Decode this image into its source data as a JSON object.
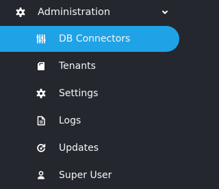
{
  "sidebar": {
    "group": {
      "label": "Administration",
      "icon": "gear-icon",
      "expanded": true
    },
    "items": [
      {
        "label": "DB Connectors",
        "icon": "sliders-icon",
        "active": true
      },
      {
        "label": "Tenants",
        "icon": "document-icon",
        "active": false
      },
      {
        "label": "Settings",
        "icon": "gear-icon",
        "active": false
      },
      {
        "label": "Logs",
        "icon": "file-lines-icon",
        "active": false
      },
      {
        "label": "Updates",
        "icon": "refresh-icon",
        "active": false
      },
      {
        "label": "Super User",
        "icon": "user-icon",
        "active": false
      }
    ]
  },
  "colors": {
    "background": "#25272f",
    "active": "#1fa2e6",
    "text": "#ffffff"
  }
}
